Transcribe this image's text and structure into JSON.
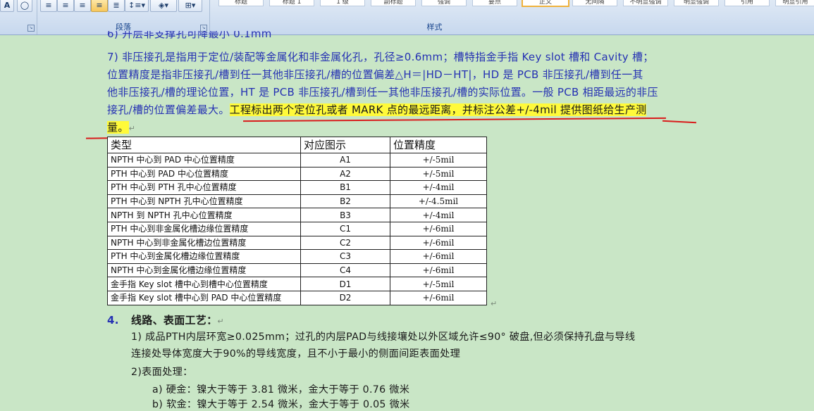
{
  "ribbon": {
    "font_icon": "A",
    "paragraph_group_label": "段落",
    "styles_group_label": "样式",
    "style_items": [
      "标题",
      "标题 1",
      "1 级",
      "副标题",
      "强调",
      "要点",
      "正文",
      "无间隔",
      "不明显强调",
      "明显强调",
      "引用",
      "明显引用"
    ]
  },
  "doc": {
    "line_top_cut": "6) 开层非支撑孔可降最小 0.1mm",
    "item7_line1": "7) 非压接孔是指用于定位/装配等金属化和非金属化孔，孔径≥0.6mm；槽特指金手指 Key slot 槽和 Cavity 槽；",
    "item7_line2": "位置精度是指非压接孔/槽到任一其他非压接孔/槽的位置偏差△H＝|HD－HT|，HD 是 PCB 非压接孔/槽到任一其",
    "item7_line3": "他非压接孔/槽的理论位置，HT 是 PCB 非压接孔/槽到任一其他非压接孔/槽的实际位置。一般 PCB 相距最远的非压",
    "item7_line4_plain": "接孔/槽的位置偏差最大。",
    "item7_line4_highlight": "工程标出两个定位孔或者 MARK 点的最远距离，并标注公差+/-4mil 提供图纸给生产测",
    "item7_line5_highlight": "量。",
    "para_mark": "↵",
    "section_number": "4.",
    "section_title": "线路、表面工艺：",
    "s1_line1": "1) 成品PTH内层环宽≥0.025mm；过孔的内层PAD与线接壤处以外区域允许≤90° 破盘,但必须保持孔盘与导线",
    "s1_line2": "连接处导体宽度大于90%的导线宽度，且不小于最小的侧面间距表面处理",
    "s2_line": "2)表面处理：",
    "s2a_line": "a) 硬金：镍大于等于 3.81 微米，金大于等于 0.76 微米",
    "s2b_line_cut": "b) 软金：镍大于等于 2.54 微米，金大于等于 0.05 微米"
  },
  "table": {
    "headers": [
      "类型",
      "对应图示",
      "位置精度"
    ],
    "rows": [
      [
        "NPTH 中心到 PAD 中心位置精度",
        "A1",
        "+/-5mil"
      ],
      [
        "PTH 中心到 PAD 中心位置精度",
        "A2",
        "+/-5mil"
      ],
      [
        "PTH 中心到 PTH 孔中心位置精度",
        "B1",
        "+/-4mil"
      ],
      [
        "PTH 中心到 NPTH 孔中心位置精度",
        "B2",
        "+/-4.5mil"
      ],
      [
        "NPTH 到 NPTH 孔中心位置精度",
        "B3",
        "+/-4mil"
      ],
      [
        "PTH 中心到非金属化槽边缘位置精度",
        "C1",
        "+/-6mil"
      ],
      [
        "NPTH 中心到非金属化槽边位置精度",
        "C2",
        "+/-6mil"
      ],
      [
        "PTH 中心到金属化槽边缘位置精度",
        "C3",
        "+/-6mil"
      ],
      [
        "NPTH 中心到金属化槽边缘位置精度",
        "C4",
        "+/-6mil"
      ],
      [
        "金手指 Key slot 槽中心到槽中心位置精度",
        "D1",
        "+/-5mil"
      ],
      [
        "金手指 Key slot 槽中心到 PAD 中心位置精度",
        "D2",
        "+/-6mil"
      ]
    ]
  },
  "colors": {
    "page_bg": "#c9e6c6",
    "text_blue": "#2531b3",
    "highlight": "#fffa3a",
    "annotation_red": "#d91c1c"
  }
}
